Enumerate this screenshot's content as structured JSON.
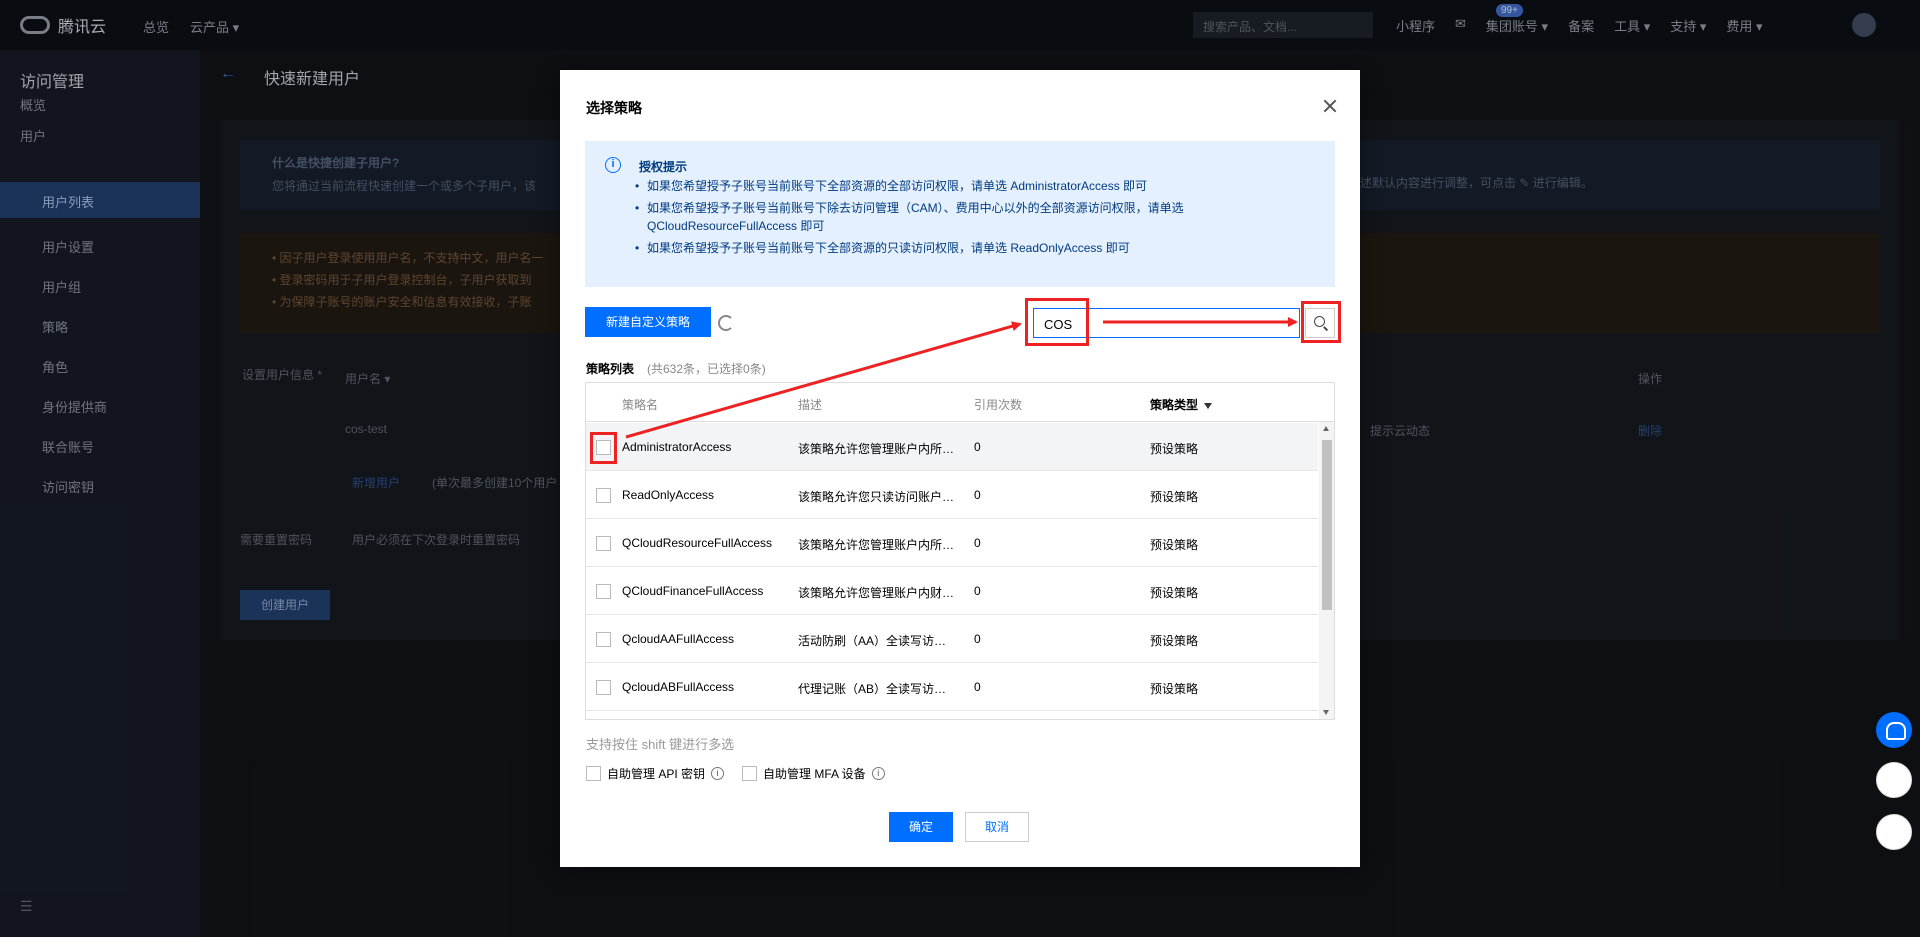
{
  "topbar": {
    "brand": "腾讯云",
    "nav_home": "总览",
    "nav_products": "云产品 ▾",
    "search_placeholder": "搜索产品、文档...",
    "miniprogram": "小程序",
    "badge": "99+",
    "group_account": "集团账号 ▾",
    "beian": "备案",
    "tools": "工具 ▾",
    "support": "支持 ▾",
    "billing": "费用 ▾"
  },
  "sidebar": {
    "title": "访问管理",
    "items": [
      "概览",
      "用户",
      "用户列表",
      "用户设置",
      "用户组",
      "策略",
      "角色",
      "身份提供商",
      "联合账号",
      "访问密钥"
    ]
  },
  "main": {
    "page_title": "快速新建用户",
    "info_title": "什么是快捷创建子用户?",
    "info_text": "您将通过当前流程快速创建一个或多个子用户，该",
    "warn_lines": [
      "• 因子用户登录使用用户名，不支持中文，用户名一",
      "• 登录密码用于子用户登录控制台，子用户获取到",
      "• 为保障子账号的账户安全和信息有效接收，子账"
    ],
    "user_info_label": "设置用户信息 *",
    "username_header": "用户名 ▾",
    "username_value": "cos-test",
    "add_user": "新增用户",
    "add_user_note": "(单次最多创建10个用户",
    "reset_pwd_label": "需要重置密码",
    "reset_pwd_text": "用户必须在下次登录时重置密码",
    "create_button": "创建用户",
    "op_header": "操作",
    "op_delete": "删除",
    "receive_msg": "提示云动态",
    "right_note": "述默认内容进行调整，可点击 ✎ 进行编辑。"
  },
  "modal": {
    "title": "选择策略",
    "tip": {
      "title": "授权提示",
      "lines": [
        "如果您希望授予子账号当前账号下全部资源的全部访问权限，请单选 AdministratorAccess 即可",
        "如果您希望授予子账号当前账号下除去访问管理（CAM）、费用中心以外的全部资源访问权限，请单选 QCloudResourceFullAccess 即可",
        "如果您希望授予子账号当前账号下全部资源的只读访问权限，请单选 ReadOnlyAccess 即可"
      ]
    },
    "new_policy_button": "新建自定义策略",
    "search_value": "COS",
    "list_label": "策略列表",
    "list_count": "(共632条，已选择0条)",
    "columns": [
      "策略名",
      "描述",
      "引用次数",
      "策略类型"
    ],
    "rows": [
      {
        "name": "AdministratorAccess",
        "desc": "该策略允许您管理账户内所有用户及其权限、财务相关的信息、云服务资产。",
        "count": "0",
        "type": "预设策略"
      },
      {
        "name": "ReadOnlyAccess",
        "desc": "该策略允许您只读访问账户内所有支持接口级鉴权或资源级鉴权的云服务资产。",
        "count": "0",
        "type": "预设策略"
      },
      {
        "name": "QCloudResourceFullAccess",
        "desc": "该策略允许您管理账户内所有云服务资产。",
        "count": "0",
        "type": "预设策略"
      },
      {
        "name": "QCloudFinanceFullAccess",
        "desc": "该策略允许您管理账户内财务相关的内容，例如：付款、开票。",
        "count": "0",
        "type": "预设策略"
      },
      {
        "name": "QcloudAAFullAccess",
        "desc": "活动防刷（AA）全读写访问权限",
        "count": "0",
        "type": "预设策略"
      },
      {
        "name": "QcloudABFullAccess",
        "desc": "代理记账（AB）全读写访问权限",
        "count": "0",
        "type": "预设策略"
      }
    ],
    "hint": "支持按住 shift 键进行多选",
    "opt_api": "自助管理 API 密钥",
    "opt_mfa": "自助管理 MFA 设备",
    "confirm": "确定",
    "cancel": "取消"
  },
  "colors": {
    "primary": "#006eff",
    "annotation": "#ee2222",
    "tip_bg": "#e5f0ff"
  }
}
